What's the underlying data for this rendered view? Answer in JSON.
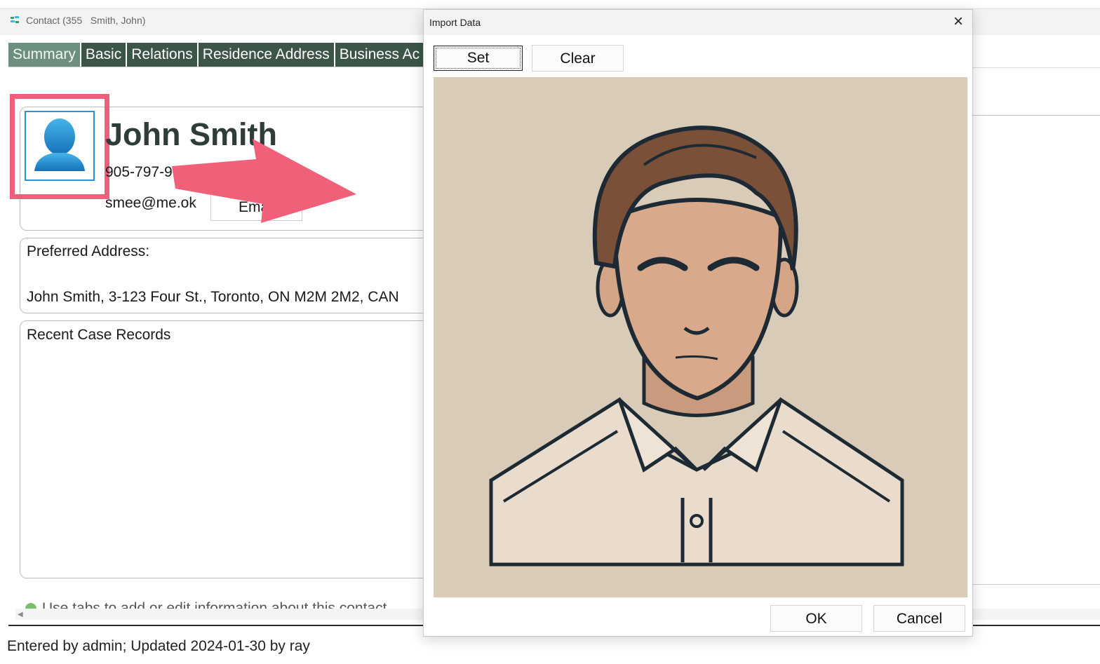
{
  "window": {
    "title": "Contact (355   Smith, John)"
  },
  "tabs": [
    {
      "label": "Summary",
      "active": true
    },
    {
      "label": "Basic",
      "active": false
    },
    {
      "label": "Relations",
      "active": false
    },
    {
      "label": "Residence Address",
      "active": false
    },
    {
      "label": "Business Ac",
      "active": false
    }
  ],
  "contact": {
    "name": "John Smith",
    "phone": "905-797-9",
    "email": "smee@me.ok",
    "email_button": "Ema"
  },
  "address": {
    "label": "Preferred Address:",
    "value": "John Smith, 3-123 Four St., Toronto, ON  M2M 2M2, CAN"
  },
  "cases": {
    "label": "Recent Case Records"
  },
  "hint": {
    "text": "Use tabs to add or edit information about this contact"
  },
  "status_bar": {
    "text": "Entered by admin; Updated 2024-01-30 by ray"
  },
  "dialog": {
    "title": "Import Data",
    "close_icon": "×",
    "set_label": "Set",
    "clear_label": "Clear",
    "ok_label": "OK",
    "cancel_label": "Cancel"
  },
  "colors": {
    "tab_bg": "#3b5648",
    "tab_active_bg": "#6d8f7e",
    "highlight": "#ef5f7b",
    "arrow": "#f06079",
    "avatar_blue": "#2a93d0",
    "photo_bg": "#d8cbb8"
  },
  "icons": {
    "app_logo": "app-logo-icon",
    "avatar": "person-silhouette-icon",
    "close": "close-icon",
    "hint": "info-icon",
    "scroll_left": "chevron-left-icon"
  }
}
